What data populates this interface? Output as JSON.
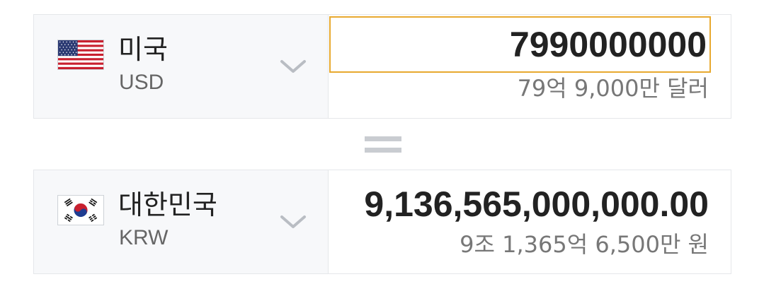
{
  "from": {
    "country": "미국",
    "currency_code": "USD",
    "flag_icon": "us-flag-icon",
    "amount_input_value": "7990000000",
    "amount_korean": "79억 9,000만 달러"
  },
  "to": {
    "country": "대한민국",
    "currency_code": "KRW",
    "flag_icon": "kr-flag-icon",
    "amount_value": "9,136,565,000,000.00",
    "amount_korean": "9조 1,365억 6,500만 원"
  },
  "equals_icon": "equals-icon",
  "dropdown_icon": "chevron-down-icon",
  "colors": {
    "input_border": "#e8a92f",
    "panel_bg": "#f7f8fa",
    "border": "#e5e7ea",
    "subtext": "#777777",
    "equals": "#c9ccd1"
  }
}
